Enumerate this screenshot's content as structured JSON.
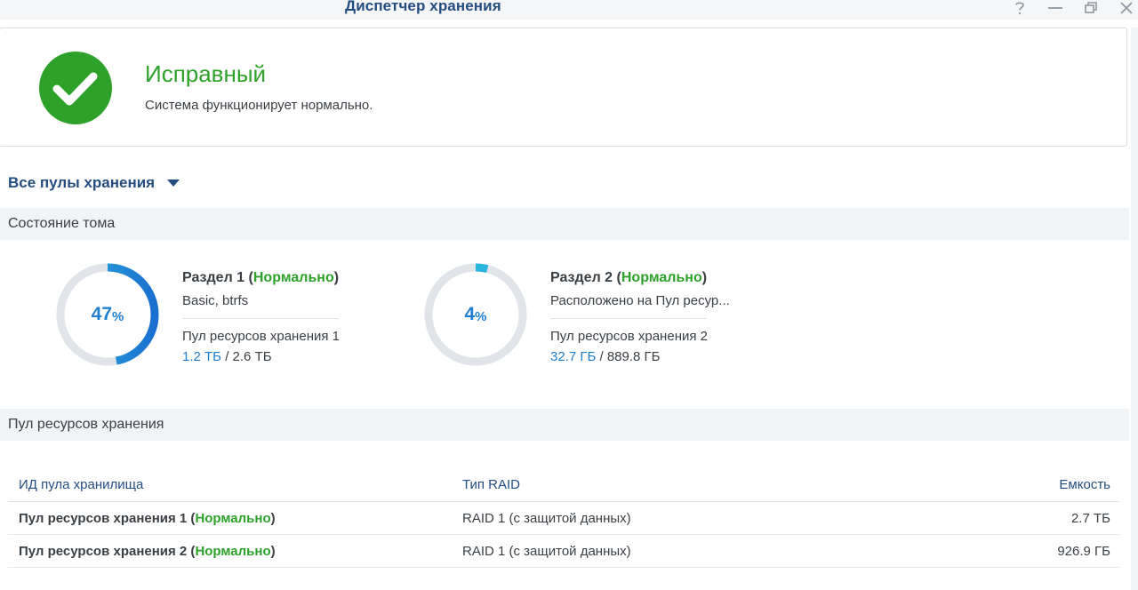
{
  "window": {
    "title": "Диспетчер хранения",
    "controls": [
      "help-icon",
      "minimize-icon",
      "restore-icon",
      "close-icon"
    ]
  },
  "health": {
    "icon": "check-circle-icon",
    "title": "Исправный",
    "description": "Система функционирует нормально.",
    "color": "#2ea12b"
  },
  "filter": {
    "label": "Все пулы хранения",
    "icon": "caret-down-icon"
  },
  "volume_section": {
    "title": "Состояние тома"
  },
  "volumes": [
    {
      "name": "Раздел 1",
      "status": "Нормально",
      "subtitle": "Basic, btrfs",
      "pool": "Пул ресурсов хранения 1",
      "used": "1.2 ТБ",
      "separator": " / ",
      "total": "2.6 ТБ",
      "percent_label": "47",
      "percent_sign": "%",
      "percent_value": 47
    },
    {
      "name": "Раздел 2",
      "status": "Нормально",
      "subtitle": "Расположено на Пул ресур...",
      "pool": "Пул ресурсов хранения 2",
      "used": "32.7 ГБ",
      "separator": " / ",
      "total": "889.8 ГБ",
      "percent_label": "4",
      "percent_sign": "%",
      "percent_value": 4
    }
  ],
  "pool_section": {
    "title": "Пул ресурсов хранения"
  },
  "pool_table": {
    "columns": [
      "ИД пула хранилища",
      "Тип RAID",
      "Емкость"
    ],
    "rows": [
      {
        "name": "Пул ресурсов хранения 1",
        "status": "Нормально",
        "raid": "RAID 1 (с защитой данных)",
        "capacity": "2.7 ТБ"
      },
      {
        "name": "Пул ресурсов хранения 2",
        "status": "Нормально",
        "raid": "RAID 1 (с защитой данных)",
        "capacity": "926.9 ГБ"
      }
    ]
  },
  "colors": {
    "accent": "#244d80",
    "ok": "#2ea12b",
    "usage": "#1f7fcf",
    "ring_track": "#e1e5e9"
  }
}
